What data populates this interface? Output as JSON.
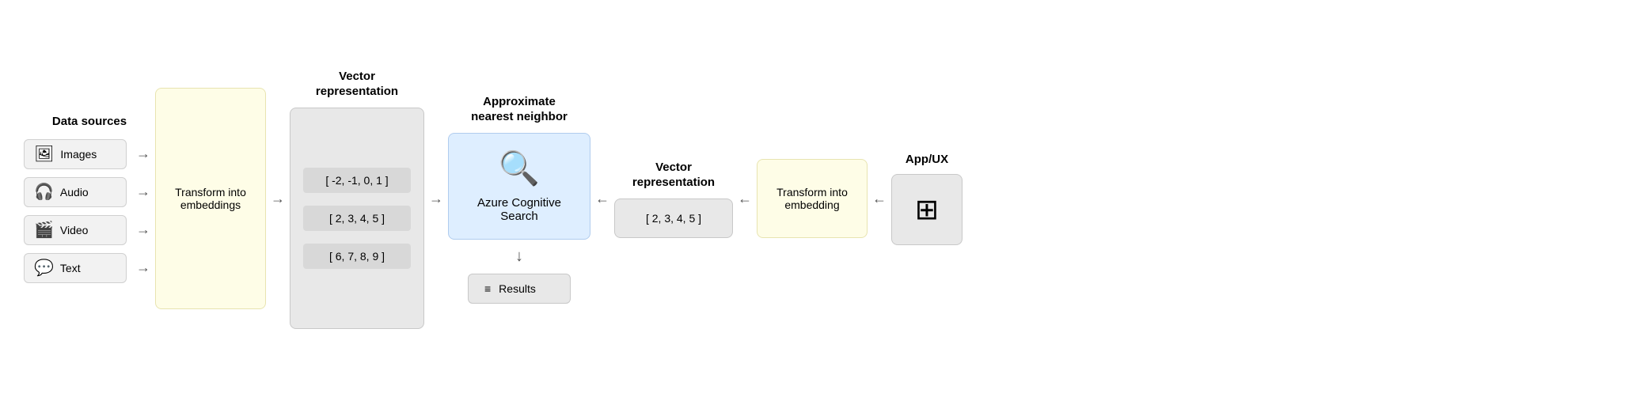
{
  "datasources": {
    "title": "Data sources",
    "items": [
      {
        "id": "images",
        "label": "Images",
        "icon": "🖼"
      },
      {
        "id": "audio",
        "label": "Audio",
        "icon": "🎧"
      },
      {
        "id": "video",
        "label": "Video",
        "icon": "🎬"
      },
      {
        "id": "text",
        "label": "Text",
        "icon": "💬"
      }
    ]
  },
  "transform_embeddings": {
    "label": "Transform into\nembeddings"
  },
  "vector_rep_left": {
    "header": "Vector\nrepresentation",
    "rows": [
      "[ -2, -1, 0, 1 ]",
      "[ 2, 3, 4, 5 ]",
      "[ 6, 7, 8, 9 ]"
    ]
  },
  "approx_nearest": {
    "header": "Approximate\nnearest neighbor"
  },
  "azure": {
    "label": "Azure Cognitive\nSearch"
  },
  "results": {
    "label": "Results"
  },
  "vector_rep_right": {
    "header": "Vector\nrepresentation",
    "value": "[ 2, 3, 4, 5 ]"
  },
  "transform_embedding_right": {
    "label": "Transform into\nembedding"
  },
  "appux": {
    "header": "App/UX"
  },
  "arrows": {
    "right": "→",
    "left": "←",
    "down": "↓"
  }
}
